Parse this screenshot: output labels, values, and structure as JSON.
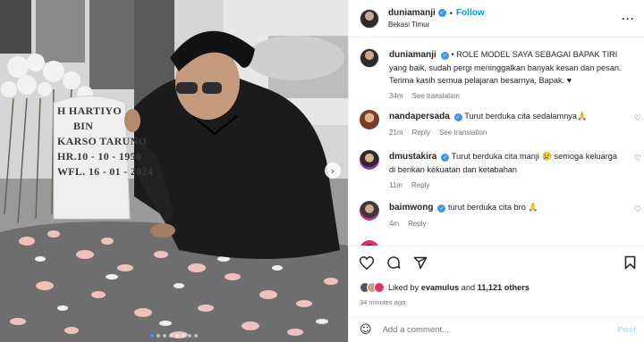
{
  "post": {
    "username": "duniamanji",
    "follow_label": "Follow",
    "location": "Bekasi Timur",
    "dot": "•"
  },
  "gravestone": {
    "lines": [
      "H HARTIYO",
      "BIN",
      "KARSO TARUNO",
      "HR.10 - 10 - 1950",
      "WFL. 16 - 01 - 2024"
    ]
  },
  "caption": {
    "username": "duniamanji",
    "text": "• ROLE MODEL SAYA SEBAGAI BAPAK TIRI yang baik, sudah pergi meninggalkan banyak kesan dan pesan. Terima kasih semua pelajaran besarnya, Bapak. ♥",
    "time": "34m",
    "see_translation": "See translation"
  },
  "comments": [
    {
      "username": "nandapersada",
      "text": "Turut berduka cita sedalamnya🙏",
      "time": "21m",
      "reply": "Reply",
      "see_translation": "See translation"
    },
    {
      "username": "dmustakira",
      "text": "Turut berduka cita manji 😢 semoga keluarga di berikan kekuatan dan ketabahan",
      "time": "11m",
      "reply": "Reply"
    },
    {
      "username": "baimwong",
      "text": "turut berduka cita bro 🙏",
      "time": "4m",
      "reply": "Reply"
    }
  ],
  "likes": {
    "prefix": "Liked by",
    "user": "evamulus",
    "and": "and",
    "count": "11,121 others"
  },
  "time_ago": "34 minutes ago",
  "add_comment": {
    "placeholder": "Add a comment...",
    "post_label": "Post"
  },
  "icons": {
    "more": "more-options-icon",
    "verified": "verified-badge-icon",
    "heart": "heart-icon",
    "comment": "comment-icon",
    "share": "share-icon",
    "save": "bookmark-icon",
    "emoji": "emoji-icon",
    "next": "chevron-right-icon"
  },
  "colors": {
    "accent": "#0095f6",
    "verified": "#3897f0",
    "text": "#262626",
    "muted": "#737373"
  }
}
